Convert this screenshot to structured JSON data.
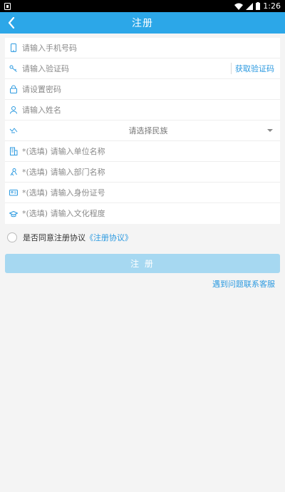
{
  "status_bar": {
    "time": "1:26"
  },
  "header": {
    "title": "注册"
  },
  "form": {
    "phone_placeholder": "请输入手机号码",
    "code_placeholder": "请输入验证码",
    "get_code_label": "获取验证码",
    "password_placeholder": "请设置密码",
    "name_placeholder": "请输入姓名",
    "ethnicity_label": "请选择民族",
    "company_placeholder": "*(选填) 请输入单位名称",
    "department_placeholder": "*(选填) 请输入部门名称",
    "id_placeholder": "*(选填) 请输入身份证号",
    "education_placeholder": "*(选填) 请输入文化程度"
  },
  "agreement": {
    "text": "是否同意注册协议",
    "link": "《注册协议》"
  },
  "submit_label": "注 册",
  "help_link": "遇到问题联系客服",
  "colors": {
    "primary": "#2ca7e8",
    "button_disabled": "#a6d8f1",
    "link": "#2c9ae0"
  }
}
